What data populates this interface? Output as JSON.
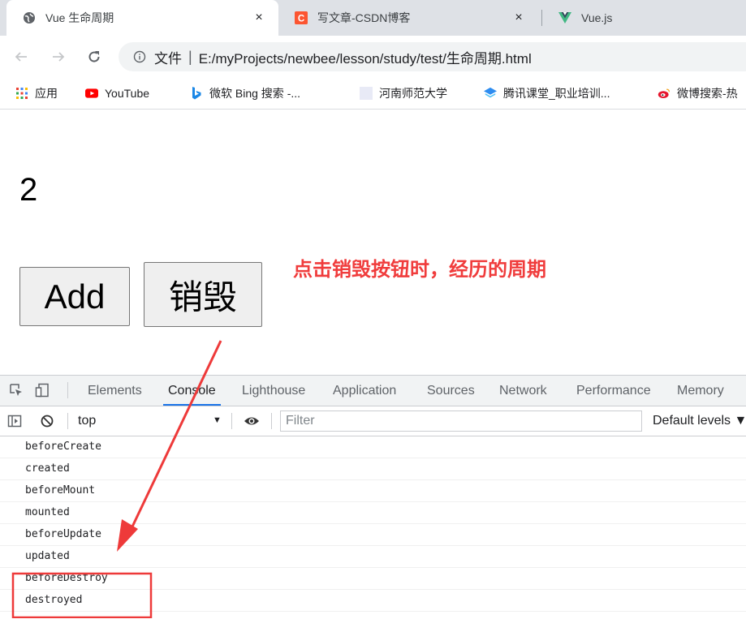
{
  "browser": {
    "tabs": [
      {
        "title": "Vue 生命周期",
        "favicon": "globe-icon",
        "close": "×",
        "active": true
      },
      {
        "title": "写文章-CSDN博客",
        "favicon": "csdn-icon",
        "close": "×",
        "active": false
      },
      {
        "title": "Vue.js",
        "favicon": "vue-icon",
        "active": false
      }
    ],
    "address_bar": {
      "scheme_label": "文件",
      "separator": "|",
      "url": "E:/myProjects/newbee/lesson/study/test/生命周期.html"
    },
    "bookmarks": [
      {
        "label": "应用",
        "icon": "apps-grid-icon"
      },
      {
        "label": "YouTube",
        "icon": "youtube-icon"
      },
      {
        "label": "微软 Bing 搜索 -...",
        "icon": "bing-icon"
      },
      {
        "label": "河南师范大学",
        "icon": "page-icon"
      },
      {
        "label": "腾讯课堂_职业培训...",
        "icon": "tencent-classroom-icon"
      },
      {
        "label": "微博搜索-热",
        "icon": "weibo-icon"
      }
    ]
  },
  "page": {
    "counter": "2",
    "add_button": "Add",
    "destroy_button": "销毁",
    "annotation_text": "点击销毁按钮时，经历的周期",
    "annotation_color": "#f03c3c"
  },
  "devtools": {
    "tabs": [
      "Elements",
      "Console",
      "Lighthouse",
      "Application",
      "Sources",
      "Network",
      "Performance",
      "Memory"
    ],
    "active_tab": "Console",
    "context": "top",
    "filter_placeholder": "Filter",
    "levels": "Default levels ▼",
    "logs": [
      "beforeCreate",
      "created",
      "beforeMount",
      "mounted",
      "beforeUpdate",
      "updated",
      "beforeDestroy",
      "destroyed"
    ],
    "highlighted_logs": [
      "beforeDestroy",
      "destroyed"
    ]
  }
}
